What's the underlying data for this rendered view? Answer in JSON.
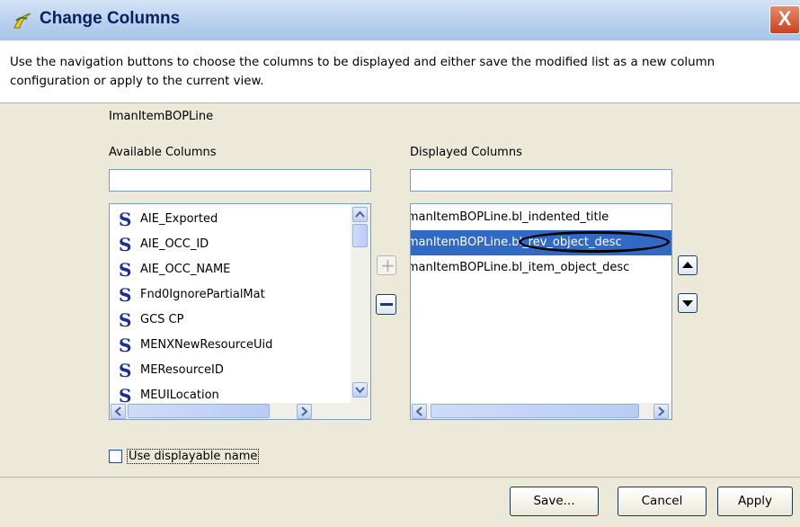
{
  "dialog": {
    "title": "Change Columns",
    "close_glyph": "X",
    "description": "Use the navigation buttons to choose the columns to be displayed and either save the modified list as a new column configuration or apply to the current view.",
    "context_type": "ImanItemBOPLine"
  },
  "available": {
    "label": "Available Columns",
    "filter_value": "",
    "type_glyph": "S",
    "items": [
      {
        "label": "AIE_Exported"
      },
      {
        "label": "AIE_OCC_ID"
      },
      {
        "label": "AIE_OCC_NAME"
      },
      {
        "label": "Fnd0IgnorePartialMat"
      },
      {
        "label": "GCS CP"
      },
      {
        "label": "MENXNewResourceUid"
      },
      {
        "label": "MEResourceID"
      },
      {
        "label": "MEUILocation"
      }
    ]
  },
  "transfer": {
    "add_glyph": "+",
    "remove_glyph": "−",
    "add_icon": "plus-icon",
    "remove_icon": "minus-icon"
  },
  "displayed": {
    "label": "Displayed Columns",
    "filter_value": "",
    "items": [
      {
        "label": "ImanItemBOPLine.bl_indented_title",
        "selected": false
      },
      {
        "label": "ImanItemBOPLine.bl_rev_object_desc",
        "selected": true
      },
      {
        "label": "ImanItemBOPLine.bl_item_object_desc",
        "selected": false
      }
    ],
    "move_up_icon": "triangle-up-icon",
    "move_down_icon": "triangle-down-icon"
  },
  "options": {
    "use_displayable_name_label": "Use displayable name",
    "use_displayable_name_checked": false
  },
  "buttons": {
    "save": "Save...",
    "cancel": "Cancel",
    "apply": "Apply"
  },
  "colors": {
    "selection": "#316ac5",
    "title_text": "#0a1f5c",
    "dialog_bg": "#ece9d8"
  }
}
